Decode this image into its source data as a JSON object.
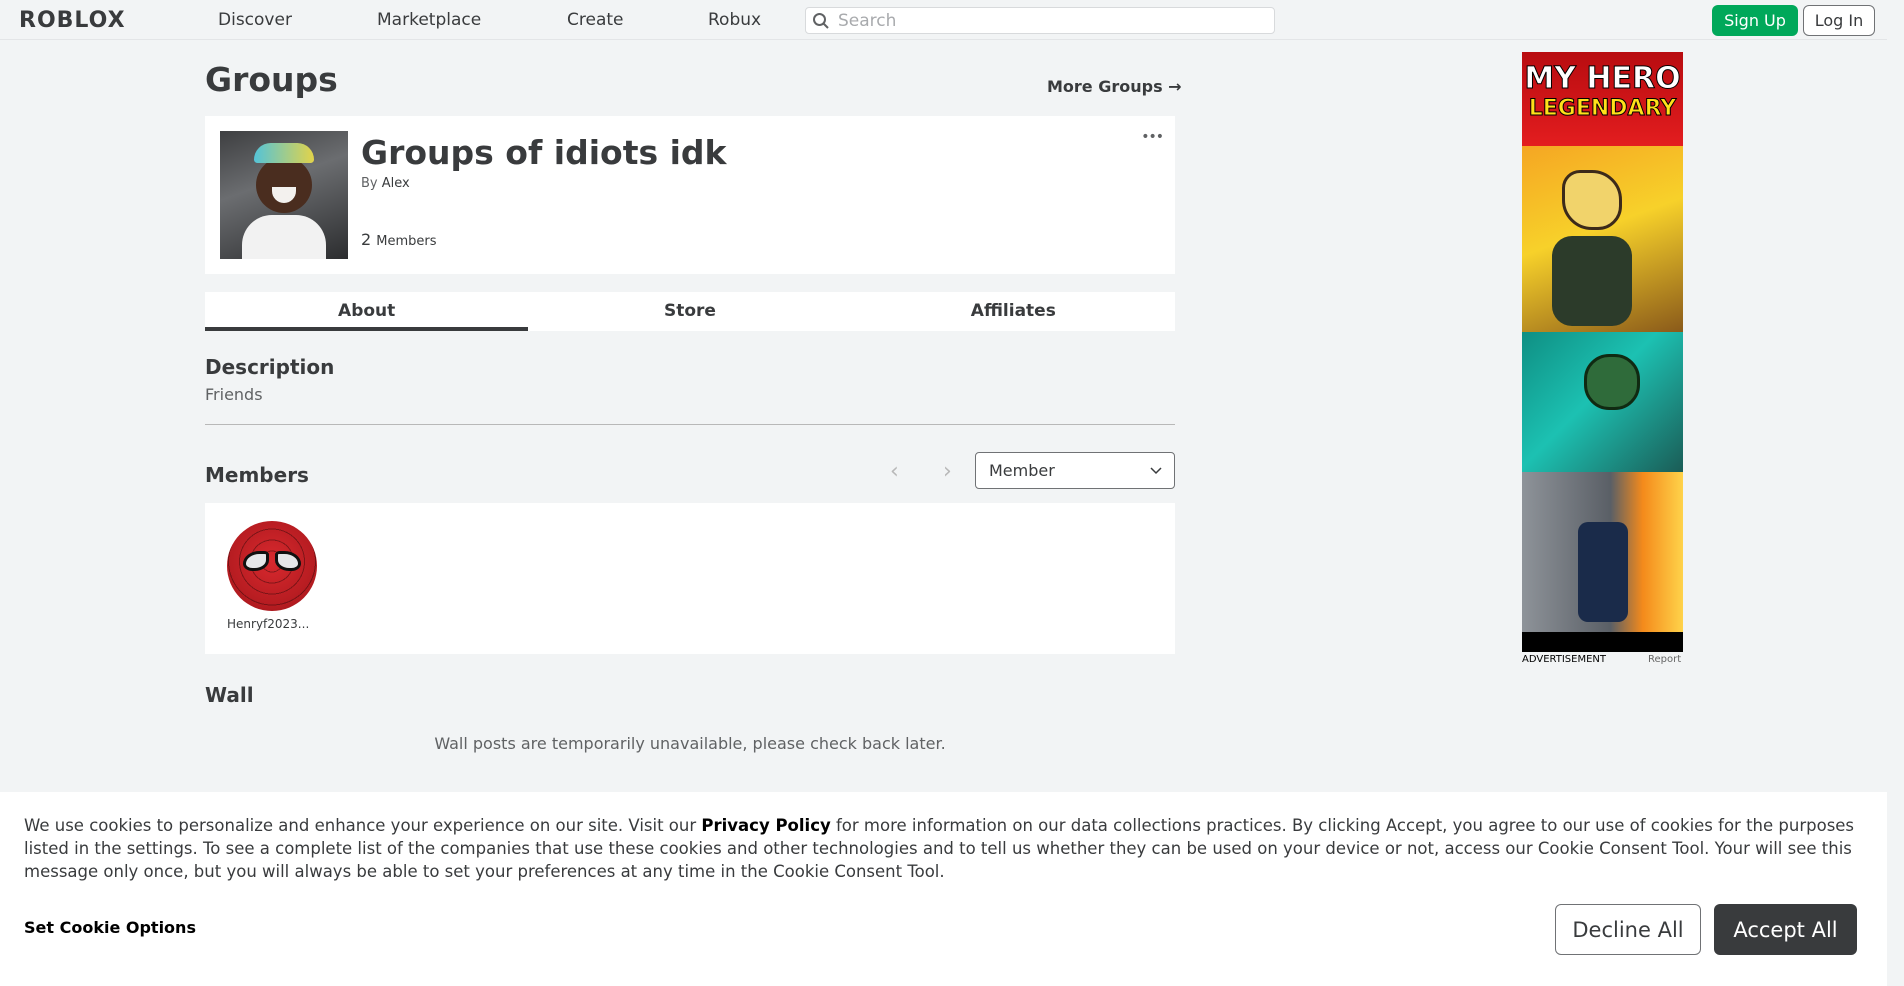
{
  "header": {
    "logo": "ROBLOX",
    "nav": [
      "Discover",
      "Marketplace",
      "Create",
      "Robux"
    ],
    "search_placeholder": "Search",
    "signup_label": "Sign Up",
    "login_label": "Log In"
  },
  "page": {
    "title": "Groups",
    "more_groups": "More Groups →"
  },
  "group": {
    "name": "Groups of idiots idk",
    "by_label": "By",
    "owner": "Alex",
    "member_count": "2",
    "members_label": "Members",
    "more_icon": "•••"
  },
  "tabs": [
    "About",
    "Store",
    "Affiliates"
  ],
  "description": {
    "title": "Description",
    "text": "Friends"
  },
  "members": {
    "title": "Members",
    "role_selected": "Member",
    "list": [
      {
        "name": "Henryf2023..."
      }
    ]
  },
  "wall": {
    "title": "Wall",
    "message": "Wall posts are temporarily unavailable, please check back later."
  },
  "ad": {
    "line1": "MY HERO",
    "line2": "LEGENDARY",
    "label": "ADVERTISEMENT",
    "report": "Report"
  },
  "cookie": {
    "text_part1": "We use cookies to personalize and enhance your experience on our site. Visit our ",
    "privacy_link": "Privacy Policy",
    "text_part2": " for more information on our data collections practices. By clicking Accept, you agree to our use of cookies for the purposes listed in the settings. To see a complete list of the companies that use these cookies and other technologies and to tell us whether they can be used on your device or not, access our Cookie Consent Tool. Your will see this message only once, but you will always be able to set your preferences at any time in the Cookie Consent Tool.",
    "set_options": "Set Cookie Options",
    "decline": "Decline All",
    "accept": "Accept All"
  },
  "colors": {
    "accent_green": "#00a85a",
    "text_dark": "#393b3d",
    "background": "#f2f4f5"
  }
}
